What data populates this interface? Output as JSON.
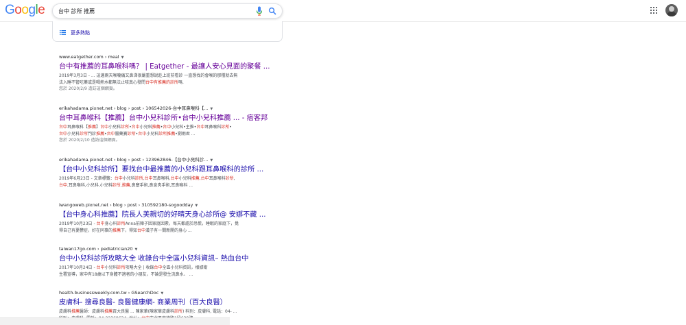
{
  "logo": {
    "letters": [
      "G",
      "o",
      "o",
      "g",
      "l",
      "e"
    ],
    "colors": [
      "#4285f4",
      "#ea4335",
      "#fbbc05",
      "#4285f4",
      "#34a853",
      "#ea4335"
    ]
  },
  "search": {
    "query": "台中 診所 推薦"
  },
  "more_results": {
    "label": "更多熱點"
  },
  "results": [
    {
      "cite": "www.eatgether.com › meal",
      "title": "台中有推薦的耳鼻喉科嗎？ | Eatgether - 最讓人安心見面的聚餐 ...",
      "visited": true,
      "lines": [
        [
          {
            "t": "2019年3月3日 - ... 這邊兩天喉嚨痛又鼻涕很嚴重想說趁上班前看診 一直想找的會喉的那種就去無"
          }
        ],
        [
          {
            "t": "法入睡不管吃藥或是喝熱水都無法止咳真心發問"
          },
          {
            "t": "台中有推薦的診所",
            "em": true
          },
          {
            "t": "嗎."
          }
        ]
      ],
      "note": "您於 2020/2/9 造訪這個網頁。"
    },
    {
      "cite": "erikahadama.pixnet.net › blog › post › 106542026-台中耳鼻喉科【...",
      "title": "台中耳鼻喉科【推薦】台中小兒科診所•台中小兒科推薦 ... - 痞客邦",
      "visited": true,
      "lines": [
        [
          {
            "t": "台中",
            "em": true
          },
          {
            "t": "耳鼻喉科【"
          },
          {
            "t": "推薦",
            "em": true
          },
          {
            "t": "】"
          },
          {
            "t": "台中",
            "em": true
          },
          {
            "t": "小兒科"
          },
          {
            "t": "診所",
            "em": true
          },
          {
            "t": "•"
          },
          {
            "t": "台中",
            "em": true
          },
          {
            "t": "小兒科"
          },
          {
            "t": "推薦",
            "em": true
          },
          {
            "t": "•"
          },
          {
            "t": "台中",
            "em": true
          },
          {
            "t": "小兒科•主推•"
          },
          {
            "t": "台中",
            "em": true
          },
          {
            "t": "耳鼻喉科"
          },
          {
            "t": "診所",
            "em": true
          },
          {
            "t": "•"
          }
        ],
        [
          {
            "t": "台中",
            "em": true
          },
          {
            "t": "小兒科"
          },
          {
            "t": "診所",
            "em": true
          },
          {
            "t": "門診"
          },
          {
            "t": "推薦",
            "em": true
          },
          {
            "t": "•"
          },
          {
            "t": "台中",
            "em": true
          },
          {
            "t": "醫藥寶"
          },
          {
            "t": "診所",
            "em": true
          },
          {
            "t": "•"
          },
          {
            "t": "台中",
            "em": true
          },
          {
            "t": "小兒科"
          },
          {
            "t": "診所",
            "em": true
          },
          {
            "t": "推薦",
            "em": true
          },
          {
            "t": "•劉雨君 ..."
          }
        ]
      ],
      "note": "您於 2020/2/10 造訪這個網頁。"
    },
    {
      "cite": "erikahadama.pixnet.net › blog › post › 123962846-【台中小兒科診...",
      "title": "【台中小兒科診所】要找台中最推薦的小兒科跟耳鼻喉科的診所 ...",
      "visited": false,
      "lines": [
        [
          {
            "t": "2019年6月23日 - 文章標籤："
          },
          {
            "t": "台中",
            "em": true
          },
          {
            "t": "小兒科"
          },
          {
            "t": "診所",
            "em": true
          },
          {
            "t": ","
          },
          {
            "t": "台中",
            "em": true
          },
          {
            "t": "耳鼻喉科,"
          },
          {
            "t": "台中",
            "em": true
          },
          {
            "t": "小兒科"
          },
          {
            "t": "推薦",
            "em": true
          },
          {
            "t": ","
          },
          {
            "t": "台中",
            "em": true
          },
          {
            "t": "耳鼻喉科"
          },
          {
            "t": "診所",
            "em": true
          },
          {
            "t": ","
          }
        ],
        [
          {
            "t": "台中",
            "em": true
          },
          {
            "t": ",耳鼻喉科,小兒科,小兒科"
          },
          {
            "t": "診所",
            "em": true
          },
          {
            "t": ","
          },
          {
            "t": "推薦",
            "em": true
          },
          {
            "t": ",鼻塞手術,鼻息肉手術,耳鼻喉科 ..."
          }
        ]
      ],
      "note": ""
    },
    {
      "cite": "iwangoweb.pixnet.net › blog › post › 310592180-sogoodday",
      "title": "【台中身心科推薦】院長人美親切的好晴天身心診所@ 安娜不藏 ...",
      "visited": false,
      "lines": [
        [
          {
            "t": "2019年10月23日 - "
          },
          {
            "t": "台中",
            "em": true
          },
          {
            "t": "身心科"
          },
          {
            "t": "診所",
            "em": true
          },
          {
            "t": "Anna前陣子因家庭因素，每天都處於恐慌，睡眠的家庭下，覺"
          }
        ],
        [
          {
            "t": "得自己有憂鬱症，好在同事的"
          },
          {
            "t": "推薦",
            "em": true
          },
          {
            "t": "下，得知"
          },
          {
            "t": "台中",
            "em": true
          },
          {
            "t": "漢子有一間新開的身心 ..."
          }
        ]
      ],
      "note": ""
    },
    {
      "cite": "taiwan17go.com › pediatrician20",
      "title": "台中小兒科診所攻略大全 收錄台中全區小兒科資訊– 熱血台中",
      "visited": false,
      "lines": [
        [
          {
            "t": "2017年10月24日 - "
          },
          {
            "t": "台中",
            "em": true
          },
          {
            "t": "小兒科"
          },
          {
            "t": "診所",
            "em": true
          },
          {
            "t": "攻略大全 | 收錄"
          },
          {
            "t": "台中",
            "em": true
          },
          {
            "t": "全區小兒科資訊，根據衛"
          }
        ],
        [
          {
            "t": "生署宣導，家中有18歲以下身體不適者的小朋友，不論是發生流鼻水、 ..."
          }
        ]
      ],
      "note": ""
    },
    {
      "cite": "health.businessweekly.com.tw › GSearchDoc",
      "title": "皮膚科- 搜尋良醫- 良醫健康網- 商業周刊（百大良醫）",
      "visited": false,
      "lines": [
        [
          {
            "t": "皮膚科"
          },
          {
            "t": "推薦",
            "em": true
          },
          {
            "t": "醫師：皮膚科"
          },
          {
            "t": "推薦",
            "em": true
          },
          {
            "t": "百大良醫 ... 陳家華(陳家華皮膚科"
          },
          {
            "t": "診所",
            "em": true
          },
          {
            "t": ")  科別：皮膚科, 電話：04- ..."
          }
        ],
        [
          {
            "t": "科別：皮膚科, 電話：04-22368634, 地址："
          },
          {
            "t": "台中",
            "em": true
          },
          {
            "t": "市北區崇德路1段639號 ..."
          }
        ]
      ],
      "note": ""
    }
  ]
}
